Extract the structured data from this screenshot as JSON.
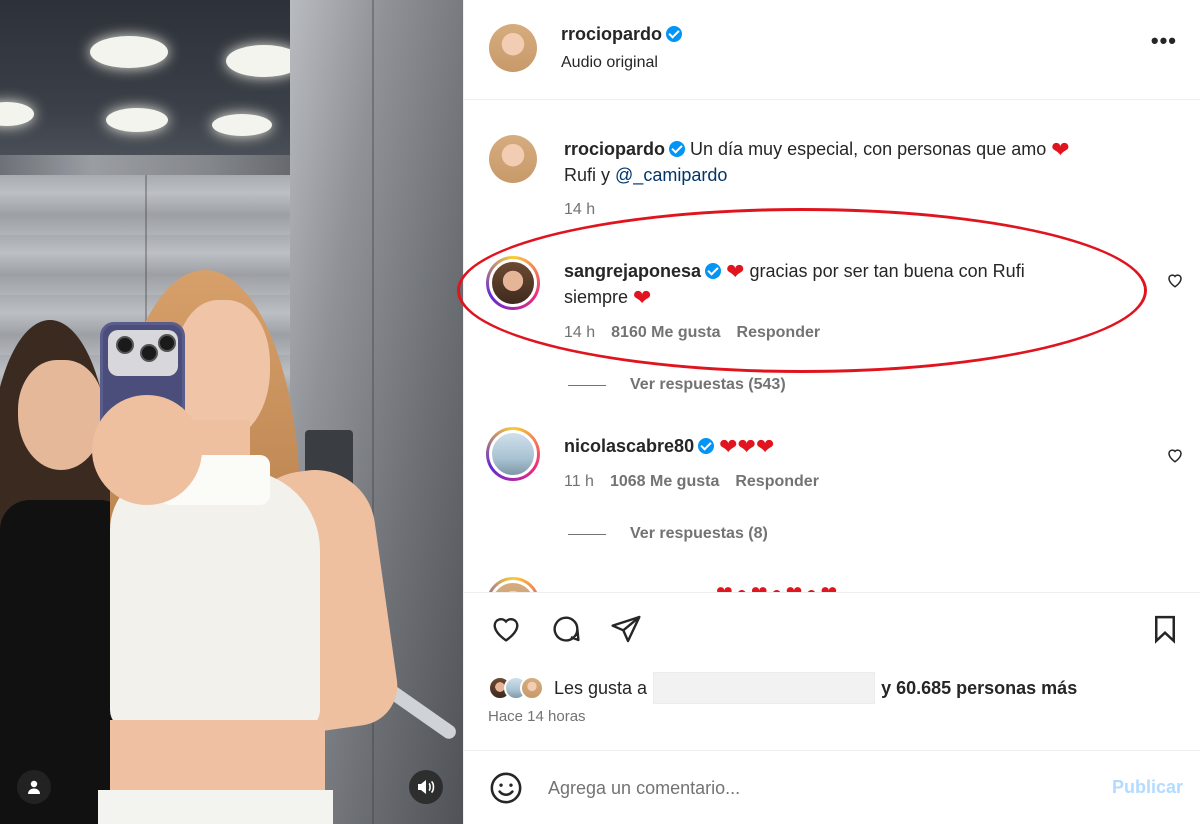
{
  "post": {
    "author": "rrociopardo",
    "audio": "Audio original",
    "more_icon": "more-horizontal-icon"
  },
  "caption": {
    "author": "rrociopardo",
    "text": "Un día muy especial, con personas que amo",
    "text_line2_prefix": "Rufi y",
    "mention": "@_camipardo",
    "time": "14 h"
  },
  "comments": [
    {
      "author": "sangrejaponesa",
      "text": "gracias por ser tan buena con Rufi",
      "text_line2": "siempre",
      "time": "14 h",
      "likes": "8160 Me gusta",
      "reply": "Responder",
      "view_replies": "Ver respuestas (543)"
    },
    {
      "author": "nicolascabre80",
      "text": "",
      "time": "11 h",
      "likes": "1068 Me gusta",
      "reply": "Responder",
      "view_replies": "Ver respuestas (8)"
    }
  ],
  "likes_summary": {
    "prefix": "Les gusta a",
    "suffix": "y 60.685 personas más",
    "posted_ago": "Hace 14 horas"
  },
  "comment_box": {
    "placeholder": "Agrega un comentario...",
    "publish": "Publicar"
  },
  "colors": {
    "verified": "#0095f6",
    "heart": "#e0151f",
    "highlight_ellipse": "#e0141e",
    "publish_disabled": "#b3dbff"
  }
}
